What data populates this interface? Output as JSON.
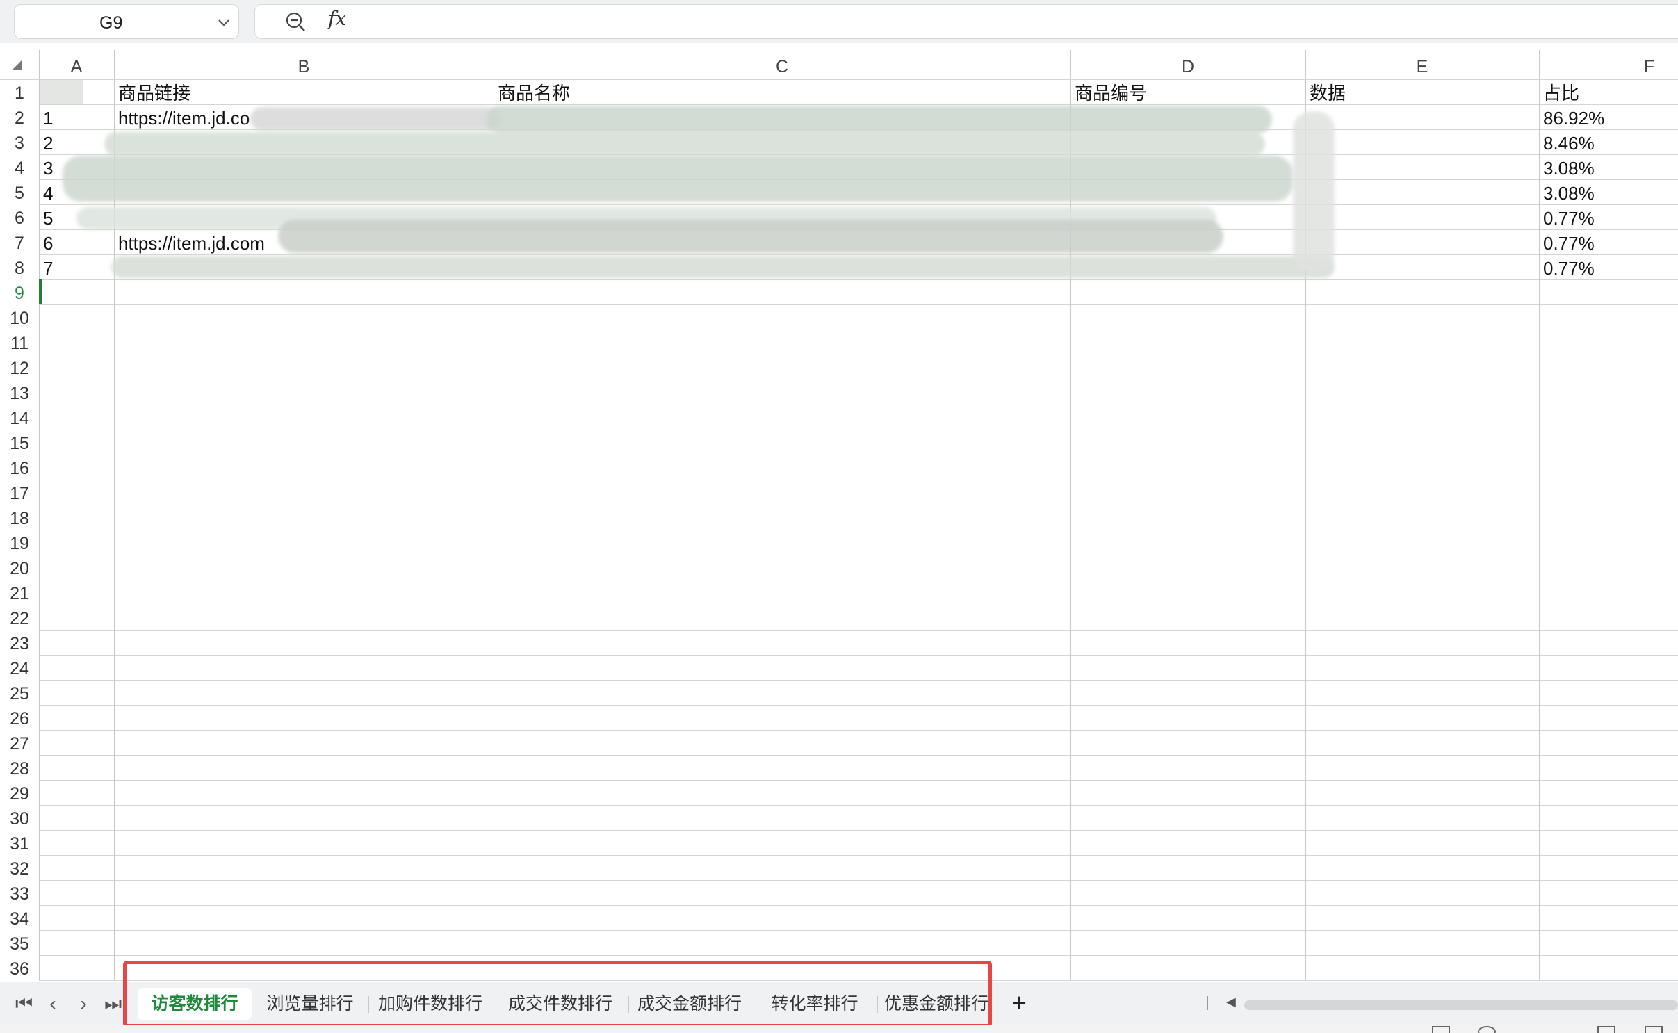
{
  "formula_bar": {
    "name_box": "G9",
    "zoom_icon": "zoom-out-icon",
    "fx_label": "fx",
    "formula": ""
  },
  "columns": [
    "A",
    "B",
    "C",
    "D",
    "E",
    "F"
  ],
  "rows": [
    "1",
    "2",
    "3",
    "4",
    "5",
    "6",
    "7",
    "8",
    "9",
    "10",
    "11",
    "12",
    "13",
    "14",
    "15",
    "16",
    "17",
    "18",
    "19",
    "20",
    "21",
    "22",
    "23",
    "24",
    "25",
    "26",
    "27",
    "28",
    "29",
    "30",
    "31",
    "32",
    "33",
    "34",
    "35",
    "36"
  ],
  "active_cell": "G9",
  "cells": {
    "B1": "商品链接",
    "C1": "商品名称",
    "D1": "商品编号",
    "E1": "数据",
    "F1": "占比",
    "A2": "1",
    "A3": "2",
    "A4": "3",
    "A5": "4",
    "A6": "5",
    "A7": "6",
    "A8": "7",
    "B2": "https://item.jd.co",
    "B7": "https://item.jd.com",
    "F2": "86.92%",
    "F3": "8.46%",
    "F4": "3.08%",
    "F5": "3.08%",
    "F6": "0.77%",
    "F7": "0.77%",
    "F8": "0.77%"
  },
  "tab_bar": {
    "nav_first": "⏮",
    "nav_prev": "‹",
    "nav_next": "›",
    "nav_last": "⏭",
    "tabs": [
      "访客数排行",
      "浏览量排行",
      "加购件数排行",
      "成交件数排行",
      "成交金额排行",
      "转化率排行",
      "优惠金额排行"
    ],
    "active_tab": "访客数排行",
    "add_label": "+"
  },
  "colors": {
    "active_tab_text": "#1f8a3b",
    "highlight_border": "#e84545",
    "active_cell_border": "#2a7a3c"
  }
}
